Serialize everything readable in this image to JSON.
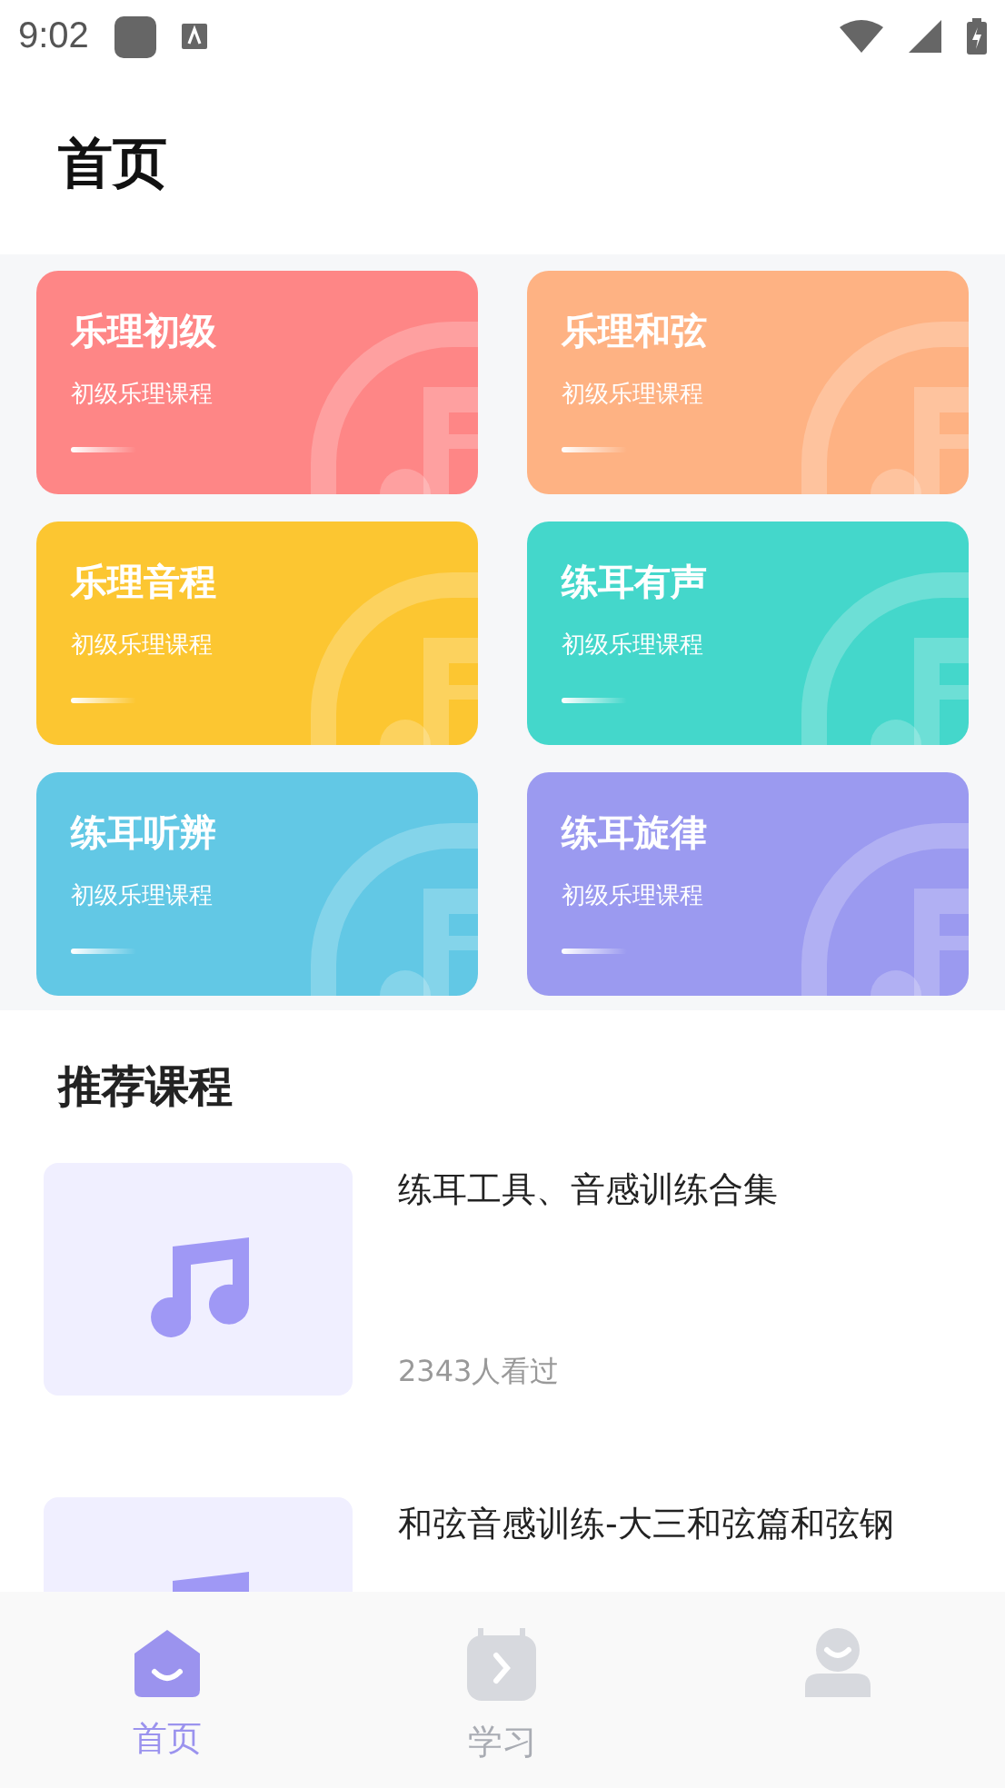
{
  "status_bar": {
    "time": "9:02"
  },
  "header": {
    "title": "首页"
  },
  "categories": [
    {
      "title": "乐理初级",
      "subtitle": "初级乐理课程",
      "color": "#fe8686"
    },
    {
      "title": "乐理和弦",
      "subtitle": "初级乐理课程",
      "color": "#feb283"
    },
    {
      "title": "乐理音程",
      "subtitle": "初级乐理课程",
      "color": "#fcc631"
    },
    {
      "title": "练耳有声",
      "subtitle": "初级乐理课程",
      "color": "#44d7cb"
    },
    {
      "title": "练耳听辨",
      "subtitle": "初级乐理课程",
      "color": "#62c8e5"
    },
    {
      "title": "练耳旋律",
      "subtitle": "初级乐理课程",
      "color": "#9b9af0"
    }
  ],
  "recommended": {
    "title": "推荐课程",
    "courses": [
      {
        "title": "练耳工具、音感训练合集",
        "views": "2343人看过"
      },
      {
        "title": "和弦音感训练-大三和弦篇和弦钢"
      }
    ]
  },
  "tab_bar": [
    {
      "kind": "home",
      "label": "首页",
      "selected": true
    },
    {
      "kind": "study",
      "label": "学习",
      "selected": false
    },
    {
      "kind": "profile",
      "selected": false
    }
  ]
}
